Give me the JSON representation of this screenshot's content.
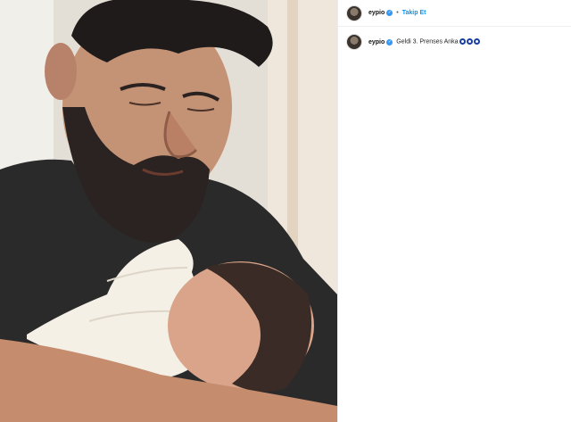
{
  "post": {
    "media_alt": "Photo",
    "header": {
      "username": "eypio",
      "separator": "•",
      "follow_label": "Takip Et"
    },
    "caption": {
      "username": "eypio",
      "text": "Geldi 3. Prenses Anka",
      "emoji_icons": [
        "nazar-icon",
        "nazar-icon",
        "nazar-icon"
      ]
    }
  },
  "colors": {
    "accent": "#0095f6",
    "verified": "#3897f0",
    "nazar": "#1a3e9e"
  }
}
